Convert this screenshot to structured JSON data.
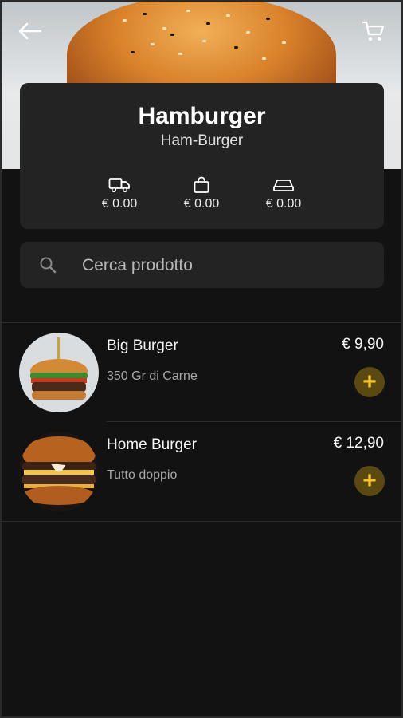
{
  "header": {
    "back_icon": "arrow-left-icon",
    "cart_icon": "cart-icon"
  },
  "category": {
    "title": "Hamburger",
    "subtitle": "Ham-Burger",
    "stats": [
      {
        "icon": "truck-icon",
        "value": "€ 0.00"
      },
      {
        "icon": "shopping-bag-icon",
        "value": "€ 0.00"
      },
      {
        "icon": "tray-icon",
        "value": "€ 0.00"
      }
    ]
  },
  "search": {
    "placeholder": "Cerca prodotto",
    "icon": "search-icon"
  },
  "products": [
    {
      "name": "Big Burger",
      "description": "350 Gr di Carne",
      "price": "€ 9,90",
      "add_label": "+"
    },
    {
      "name": "Home Burger",
      "description": "Tutto doppio",
      "price": "€ 12,90",
      "add_label": "+"
    }
  ],
  "colors": {
    "background": "#121212",
    "card": "#232323",
    "accent": "#f4c430",
    "accent_bg": "#5a4a12"
  }
}
